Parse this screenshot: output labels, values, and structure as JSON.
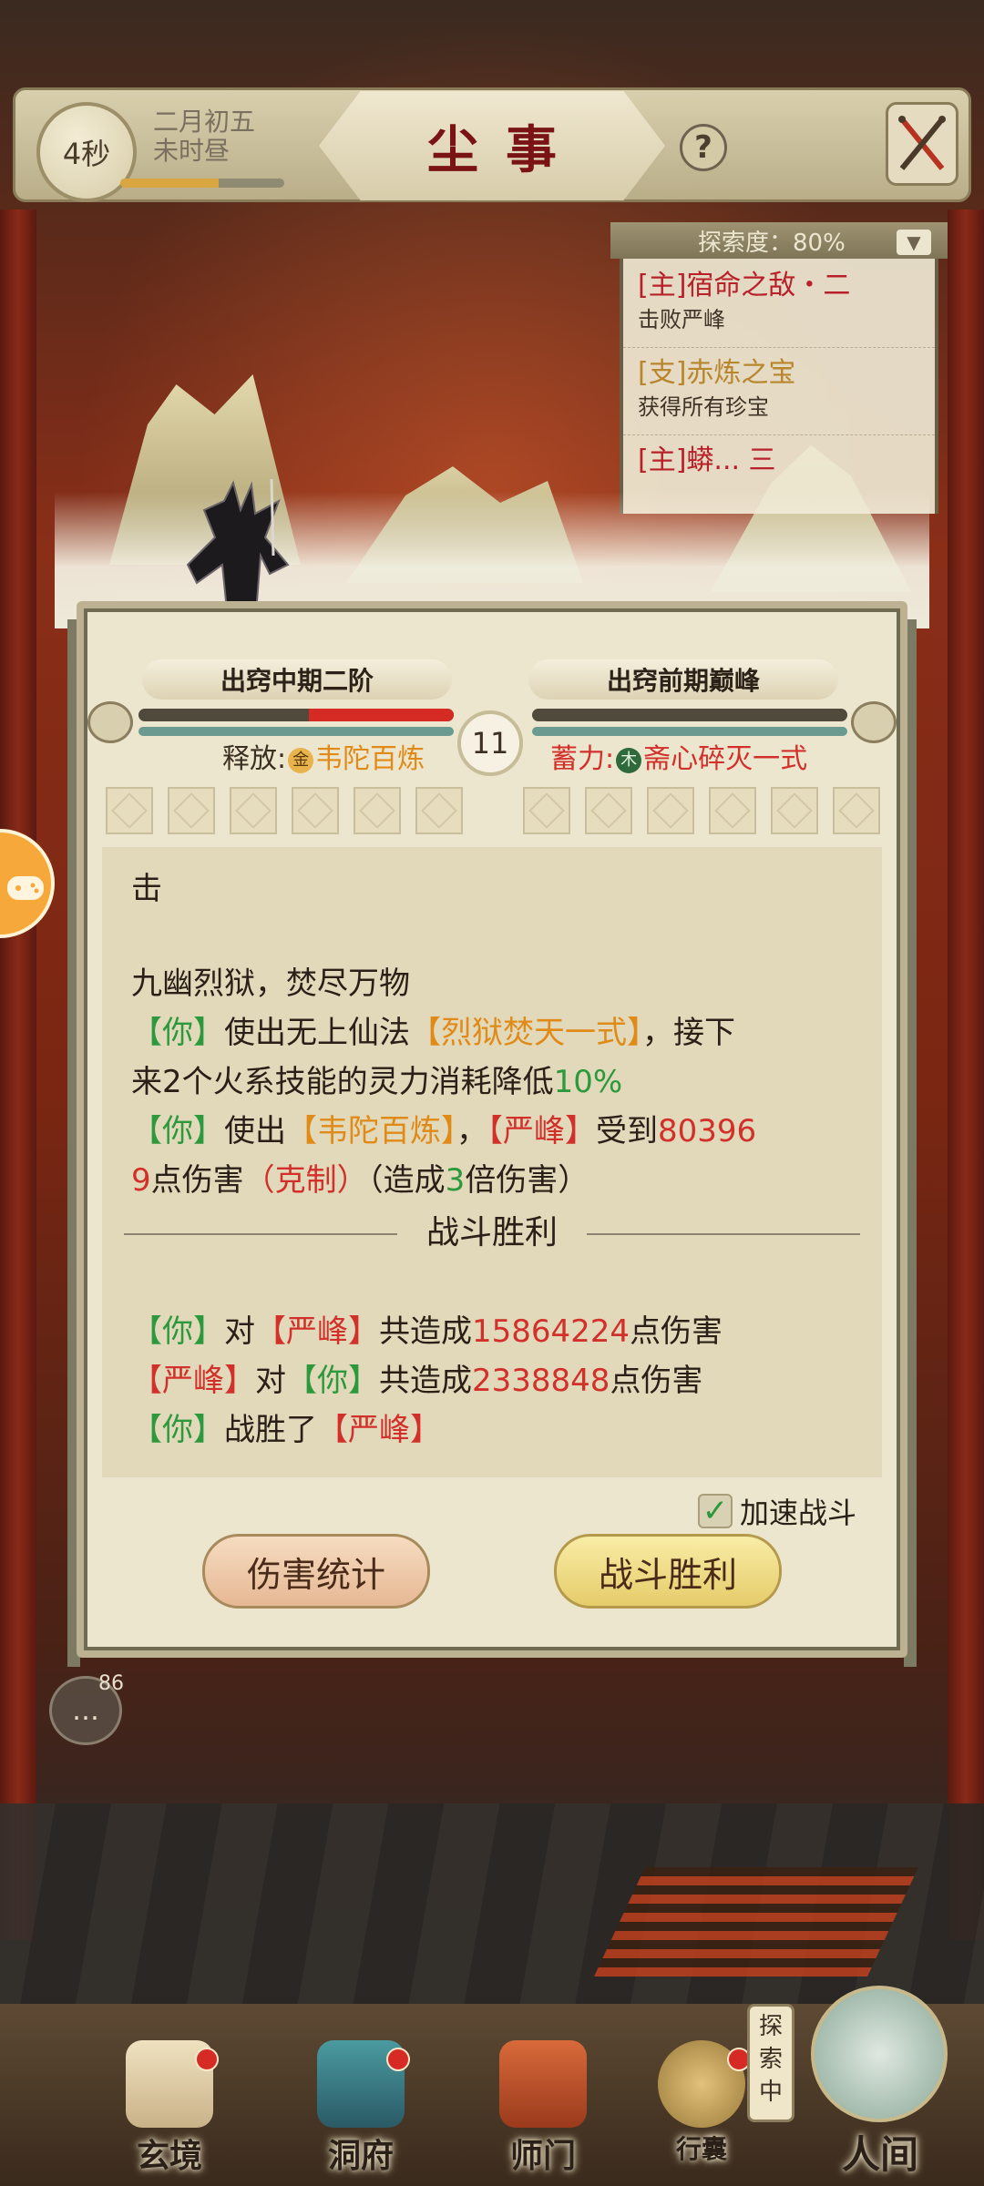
{
  "header": {
    "timer": "4秒",
    "date_line1": "二月初五",
    "date_line2": "未时昼",
    "time_progress": 0.6,
    "title": "尘事",
    "help": "?"
  },
  "quest": {
    "exploration_label": "探索度：80%",
    "items": [
      {
        "title": "[主]宿命之敌・二",
        "desc": "击败严峰",
        "type": "main"
      },
      {
        "title": "[支]赤炼之宝",
        "desc": "获得所有珍宝",
        "type": "side"
      },
      {
        "title": "[主]蟒... 三",
        "desc": "",
        "type": "main"
      }
    ]
  },
  "battle": {
    "player_realm": "出窍中期二阶",
    "enemy_realm": "出窍前期巅峰",
    "player_hp": 0.46,
    "enemy_hp": 0.0,
    "round": "11",
    "release_label": "释放:",
    "release_element": "金",
    "release_skill": "韦陀百炼",
    "charge_label": "蓄力:",
    "charge_element": "木",
    "charge_skill": "斋心碎灭一式"
  },
  "log": {
    "l1": "击",
    "l2": "九幽烈狱，焚尽万物",
    "l3_you": "【你】",
    "l3_mid": "使出无上仙法",
    "l3_skill": "【烈狱焚天一式】",
    "l3_end": "，接下",
    "l4_text": "来2个火系技能的灵力消耗降低",
    "l4_pct": "10%",
    "l5_you": "【你】",
    "l5_mid": "使出",
    "l5_skill": "【韦陀百炼】",
    "l5_comma": "，",
    "l5_enemy": "【严峰】",
    "l5_recv": "受到",
    "l5_dmg": "80396",
    "l6_dmg": "9",
    "l6_text": "点伤害",
    "l6_counter": "（克制）",
    "l6_pre": "（造成",
    "l6_mult": "3",
    "l6_post": "倍伤害）",
    "victory": "战斗胜利",
    "s1_you": "【你】",
    "s1_to": "对",
    "s1_enemy": "【严峰】",
    "s1_total": "共造成",
    "s1_num": "15864224",
    "s1_unit": "点伤害",
    "s2_enemy": "【严峰】",
    "s2_to": "对",
    "s2_you": "【你】",
    "s2_total": "共造成",
    "s2_num": "2338848",
    "s2_unit": "点伤害",
    "s3_you": "【你】",
    "s3_win": "战胜了",
    "s3_enemy": "【严峰】"
  },
  "controls": {
    "speed_label": "加速战斗",
    "speed_checked": true,
    "damage_stats_button": "伤害统计",
    "victory_button": "战斗胜利"
  },
  "chat": {
    "count": "86"
  },
  "nav": {
    "items": [
      "玄境",
      "洞府",
      "师门",
      "行囊"
    ],
    "explore_tag": "探索中",
    "renjian": "人间"
  }
}
